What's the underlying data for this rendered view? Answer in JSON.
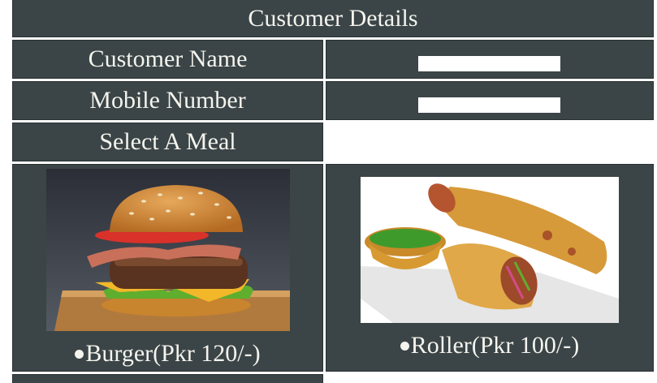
{
  "form": {
    "title": "Customer Details",
    "customer_name_label": "Customer Name",
    "customer_name_value": "",
    "mobile_number_label": "Mobile Number",
    "mobile_number_value": "",
    "select_meal_label": "Select A Meal"
  },
  "meals": [
    {
      "label": "Burger(Pkr 120/-)",
      "image": "burger-image",
      "selected": false
    },
    {
      "label": "Roller(Pkr 100/-)",
      "image": "roller-image",
      "selected": false
    }
  ],
  "colors": {
    "cell_background": "#3b4446",
    "text": "#f4f4ee",
    "page_background": "#ffffff"
  }
}
